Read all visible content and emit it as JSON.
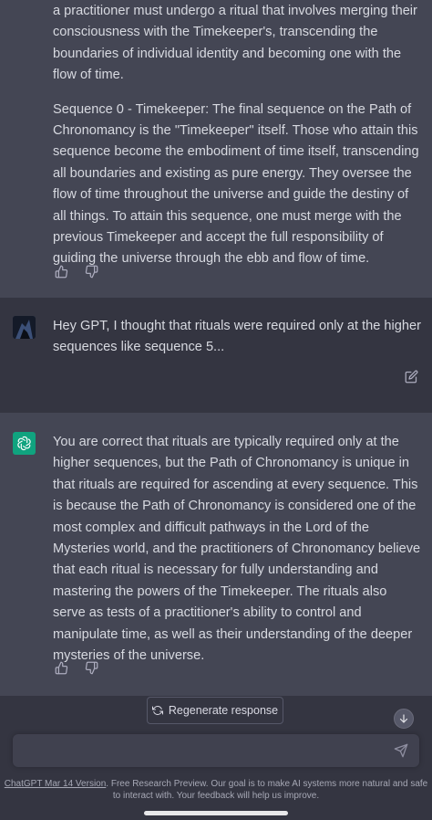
{
  "conversation": {
    "first_message": {
      "paragraphs": [
        "a practitioner must undergo a ritual that involves merging their consciousness with the Timekeeper's, transcending the boundaries of individual identity and becoming one with the flow of time.",
        "Sequence 0 - Timekeeper: The final sequence on the Path of Chronomancy is the \"Timekeeper\" itself. Those who attain this sequence become the embodiment of time itself, transcending all boundaries and existing as pure energy. They oversee the flow of time throughout the universe and guide the destiny of all things. To attain this sequence, one must merge with the previous Timekeeper and accept the full responsibility of guiding the universe through the ebb and flow of time."
      ]
    },
    "user_message": {
      "text": "Hey GPT, I thought that rituals were required only at the higher sequences like sequence 5..."
    },
    "second_message": {
      "text": "You are correct that rituals are typically required only at the higher sequences, but the Path of Chronomancy is unique in that rituals are required for ascending at every sequence. This is because the Path of Chronomancy is considered one of the most complex and difficult pathways in the Lord of the Mysteries world, and the practitioners of Chronomancy believe that each ritual is necessary for fully understanding and mastering the powers of the Timekeeper. The rituals also serve as tests of a practitioner's ability to control and manipulate time, as well as their understanding of the deeper mysteries of the universe."
    }
  },
  "controls": {
    "regenerate_label": "Regenerate response",
    "input_placeholder": ""
  },
  "footer": {
    "link_text": "ChatGPT Mar 14 Version",
    "text": ". Free Research Preview. Our goal is to make AI systems more natural and safe to interact with. Your feedback will help us improve."
  },
  "icons": {
    "thumbs_up": "thumbs-up-icon",
    "thumbs_down": "thumbs-down-icon",
    "edit": "edit-icon",
    "regenerate": "refresh-icon",
    "scroll_down": "arrow-down-icon",
    "send": "send-icon",
    "assistant_logo": "openai-logo-icon"
  },
  "colors": {
    "assistant_bg": "#444654",
    "user_bg": "#343541",
    "brand_green": "#10a37f",
    "input_bg": "#40414f"
  }
}
